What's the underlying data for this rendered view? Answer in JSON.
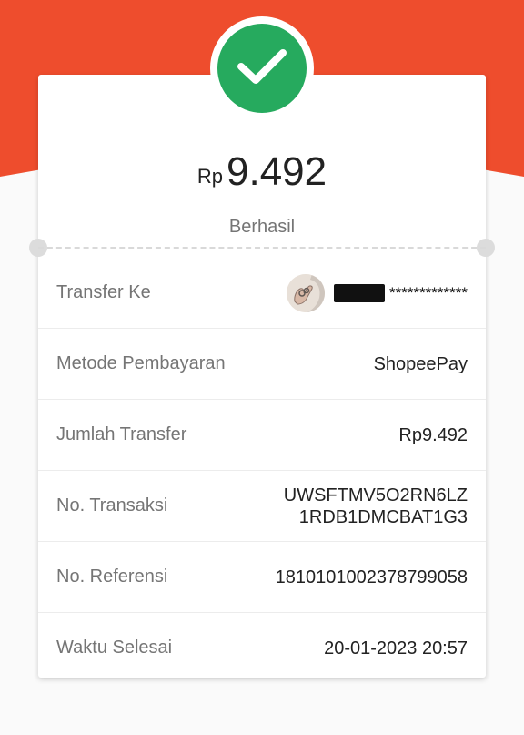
{
  "summary": {
    "currency": "Rp",
    "amount": "9.492",
    "status": "Berhasil"
  },
  "details": {
    "transfer_to": {
      "label": "Transfer Ke",
      "masked_name": "*************"
    },
    "payment_method": {
      "label": "Metode Pembayaran",
      "value": "ShopeePay"
    },
    "transfer_amount": {
      "label": "Jumlah Transfer",
      "value": "Rp9.492"
    },
    "transaction_no": {
      "label": "No. Transaksi",
      "line1": "UWSFTMV5O2RN6LZ",
      "line2": "1RDB1DMCBAT1G3"
    },
    "reference_no": {
      "label": "No. Referensi",
      "value": "1810101002378799058"
    },
    "completed_time": {
      "label": "Waktu Selesai",
      "value": "20-01-2023 20:57"
    }
  },
  "colors": {
    "brand": "#ee4d2d",
    "success": "#26aa5e"
  },
  "icons": {
    "status": "check-icon",
    "recipient": "avatar"
  }
}
